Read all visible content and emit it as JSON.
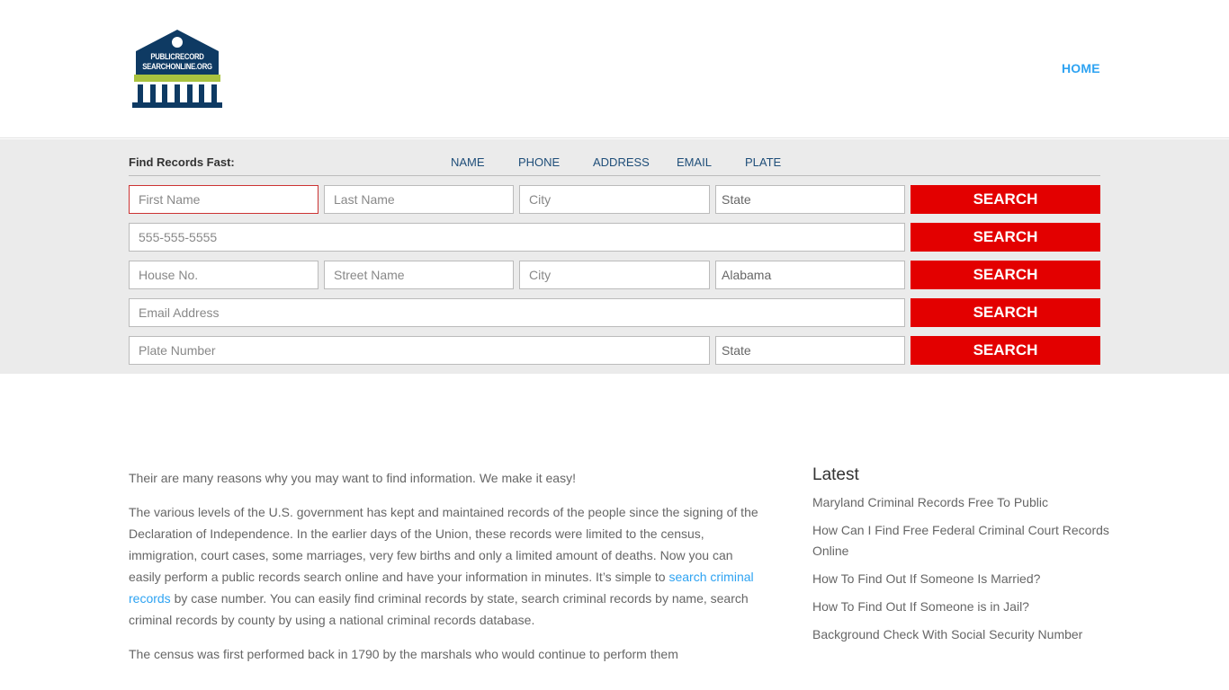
{
  "header": {
    "logo_text_line1": "PUBLICRECORD",
    "logo_text_line2": "SEARCHONLINE.ORG",
    "nav_home": "HOME"
  },
  "search": {
    "find_label": "Find Records Fast:",
    "tabs": [
      "NAME",
      "PHONE",
      "ADDRESS",
      "EMAIL",
      "PLATE"
    ],
    "button_label": "SEARCH",
    "name_row": {
      "first_placeholder": "First Name",
      "last_placeholder": "Last Name",
      "city_placeholder": "City",
      "state_value": "State"
    },
    "phone_row": {
      "phone_placeholder": "555-555-5555"
    },
    "address_row": {
      "house_placeholder": "House No.",
      "street_placeholder": "Street Name",
      "city_placeholder": "City",
      "state_value": "Alabama"
    },
    "email_row": {
      "email_placeholder": "Email Address"
    },
    "plate_row": {
      "plate_placeholder": "Plate Number",
      "state_value": "State"
    }
  },
  "content": {
    "p1": "Their are many reasons why you may want to find information. We make it easy!",
    "p2_before_link": "The various levels of the U.S. government has kept and maintained records of the people since the signing of the Declaration of Independence. In the earlier days of the Union, these records were limited to the census, immigration, court cases, some marriages, very few births and only a limited amount of deaths. Now you can easily perform a public records search online and have your information in minutes. It’s simple to ",
    "p2_link": "search criminal records",
    "p2_after_link": " by case number. You can easily find criminal records by state, search criminal records by name, search criminal records by county by using a national criminal records database.",
    "p3": "The census was first performed back in 1790 by the marshals who would continue to perform them"
  },
  "sidebar": {
    "heading": "Latest",
    "items": [
      "Maryland Criminal Records Free To Public",
      "How Can I Find Free Federal Criminal Court Records Online",
      "How To Find Out If Someone Is Married?",
      "How To Find Out If Someone is in Jail?",
      "Background Check With Social Security Number"
    ]
  },
  "colors": {
    "accent_link": "#2ea3f2",
    "search_button": "#e30000",
    "logo_navy": "#0e3a63",
    "logo_green": "#a9c23f"
  }
}
